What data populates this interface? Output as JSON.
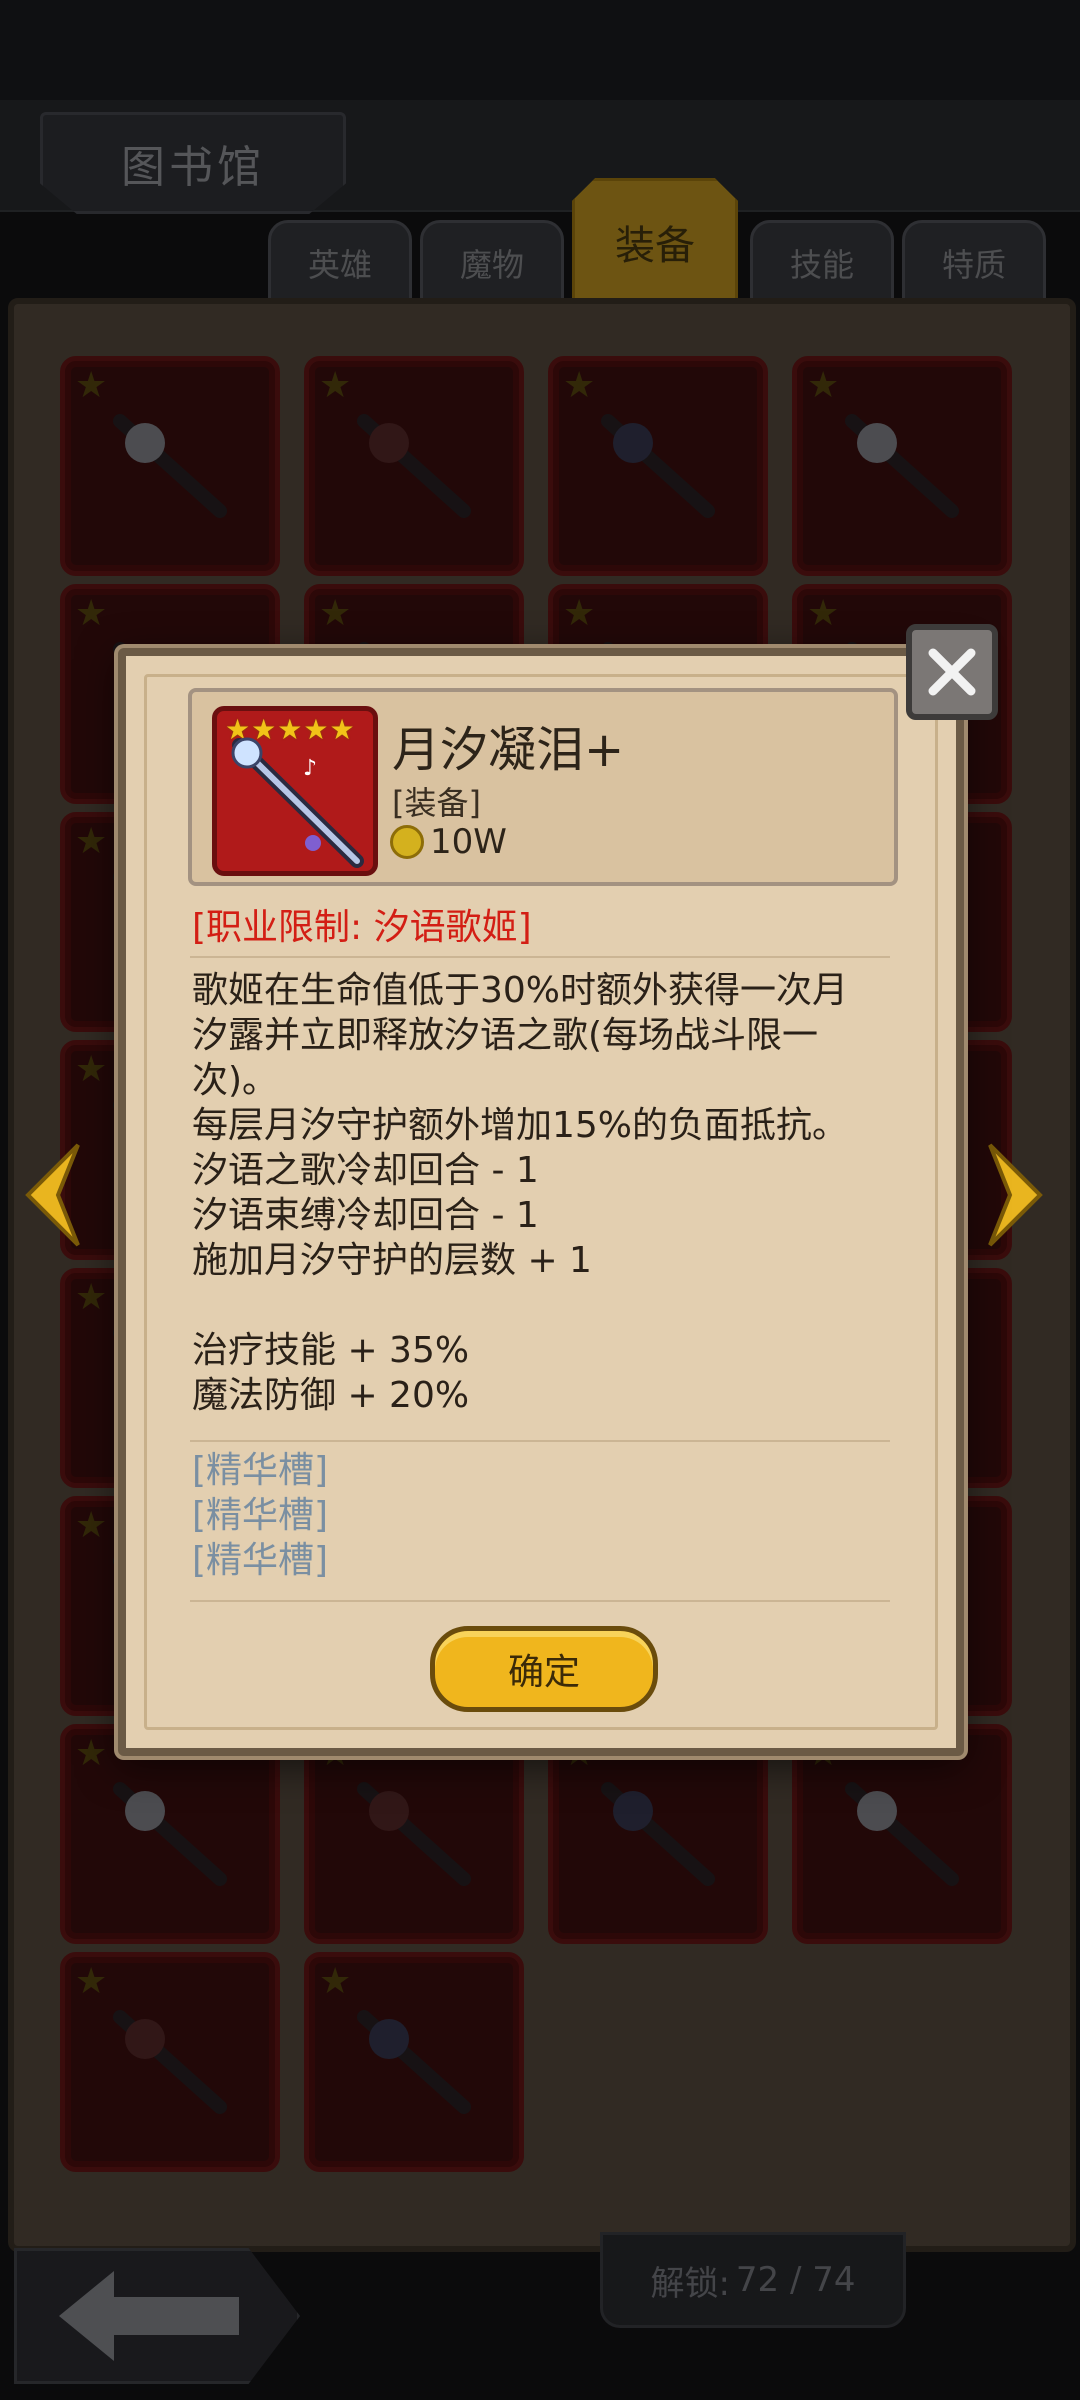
{
  "header": {
    "title": "图书馆"
  },
  "tabs": [
    {
      "label": "英雄"
    },
    {
      "label": "魔物"
    },
    {
      "label": "装备",
      "active": true
    },
    {
      "label": "技能"
    },
    {
      "label": "特质"
    }
  ],
  "footer": {
    "unlock_label": "解锁:",
    "unlock_value": "72 / 74"
  },
  "item": {
    "stars": 5,
    "name": "月汐凝泪+",
    "type": "[装备]",
    "price": "10W",
    "restriction": "[职业限制: 汐语歌姬]",
    "description": [
      "歌姬在生命值低于30%时额外获得一次月",
      "汐露并立即释放汐语之歌(每场战斗限一",
      "次)。",
      "每层月汐守护额外增加15%的负面抵抗。",
      "汐语之歌冷却回合 - 1",
      "汐语束缚冷却回合 - 1",
      "施加月汐守护的层数 + 1",
      "",
      "治疗技能 + 35%",
      "魔法防御 + 20%"
    ],
    "essence_slots": [
      "[精华槽]",
      "[精华槽]",
      "[精华槽]"
    ]
  },
  "confirm_label": "确定",
  "colors": {
    "gold": "#f0b61d",
    "restriction_red": "#d31e14",
    "slot_empty": "#7a8fa2",
    "card_bg": "#e3cfb0"
  }
}
